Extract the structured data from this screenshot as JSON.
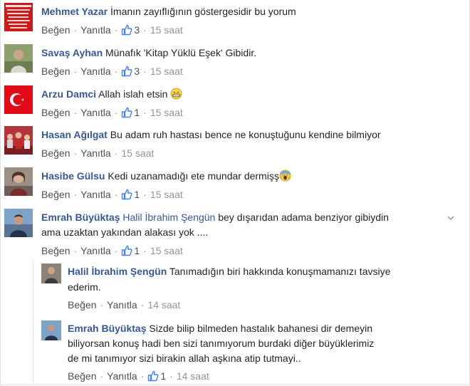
{
  "colors": {
    "name": "#365899",
    "text": "#1d2129",
    "meta": "#90949c",
    "link": "#4b4f56",
    "like_blue": "#4080ff"
  },
  "comments": [
    {
      "name": "Mehmet Yazar",
      "text": "İmanın zayıflığının göstergesidir bu yorum",
      "like": "Beğen",
      "reply": "Yanıtla",
      "likes": "3",
      "time": "15 saat",
      "avatar_text": "ÇETİN ARKADAŞ",
      "avatar_icon": "red-poster-avatar"
    },
    {
      "name": "Savaş Ayhan",
      "text": "Münafık 'Kitap Yüklü Eşek' Gibidir.",
      "like": "Beğen",
      "reply": "Yanıtla",
      "likes": "3",
      "time": "15 saat",
      "avatar_icon": "person-photo-avatar"
    },
    {
      "name": "Arzu Damci",
      "text": "Allah islah etsin",
      "like": "Beğen",
      "reply": "Yanıtla",
      "likes": "1",
      "time": "15 saat",
      "avatar_icon": "turkish-flag-avatar",
      "emoji": "grimace-emoji-icon"
    },
    {
      "name": "Hasan Ağılgat",
      "text": "Bu adam ruh hastası bence ne konuştuğunu kendine bilmiyor",
      "like": "Beğen",
      "reply": "Yanıtla",
      "time": "15 saat",
      "avatar_icon": "crowd-photo-avatar"
    },
    {
      "name": "Hasibe Gülsu",
      "text": "Kedi uzanamadığı ete mundar dermişş",
      "like": "Beğen",
      "reply": "Yanıtla",
      "likes": "1",
      "time": "15 saat",
      "avatar_icon": "person-photo-avatar",
      "emoji": "scream-emoji-icon"
    },
    {
      "name": "Emrah Büyüktaş",
      "mention": "Halil İbrahim Şengün",
      "text": " bey dışarıdan adama benziyor gibiydin",
      "text2": "ama uzaktan yakından alakası yok ....",
      "like": "Beğen",
      "reply": "Yanıtla",
      "likes": "1",
      "time": "15 saat",
      "avatar_icon": "person-photo-avatar"
    }
  ],
  "replies": [
    {
      "name": "Halil İbrahim Şengün",
      "text": "Tanımadığın biri hakkında konuşmamanızı tavsiye",
      "text2": "ederim.",
      "like": "Beğen",
      "reply": "Yanıtla",
      "time": "14 saat",
      "avatar_icon": "person-photo-avatar"
    },
    {
      "name": "Emrah Büyüktaş",
      "text": "Sizde bilip bilmeden hastalık bahanesi dir demeyin",
      "text2": "biliyorsan konuş hadi ben sizi tanımıyorum burdaki diğer büyüklerimiz",
      "text3": "de mi tanımıyor sizi birakin allah aşkına atip tutmayi..",
      "like": "Beğen",
      "reply": "Yanıtla",
      "likes": "1",
      "time": "14 saat",
      "avatar_icon": "person-photo-avatar"
    }
  ]
}
